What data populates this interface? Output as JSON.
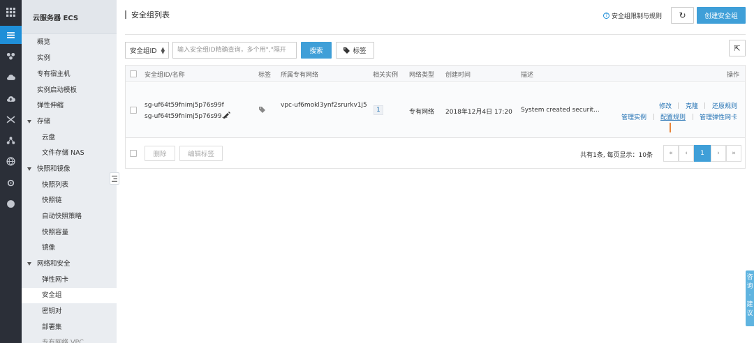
{
  "sidebar": {
    "title": "云服务器 ECS",
    "items": [
      {
        "label": "概览"
      },
      {
        "label": "实例"
      },
      {
        "label": "专有宿主机"
      },
      {
        "label": "实例启动模板"
      },
      {
        "label": "弹性伸缩"
      },
      {
        "label": "存储"
      },
      {
        "label": "云盘"
      },
      {
        "label": "文件存储 NAS"
      },
      {
        "label": "快照和镜像"
      },
      {
        "label": "快照列表"
      },
      {
        "label": "快照链"
      },
      {
        "label": "自动快照策略"
      },
      {
        "label": "快照容量"
      },
      {
        "label": "镜像"
      },
      {
        "label": "网络和安全"
      },
      {
        "label": "弹性网卡"
      },
      {
        "label": "安全组"
      },
      {
        "label": "密钥对"
      },
      {
        "label": "部署集"
      },
      {
        "label": "专有网络 VPC"
      }
    ]
  },
  "page": {
    "title": "安全组列表",
    "help_link": "安全组限制与规则",
    "refresh_icon": "↻",
    "create_button": "创建安全组",
    "export_icon": "⇱"
  },
  "filter": {
    "select_value": "安全组ID",
    "search_placeholder": "输入安全组ID精确查询，多个用\",\"隔开",
    "search_button": "搜索",
    "tag_button": "标签"
  },
  "table": {
    "headers": {
      "id_name": "安全组ID/名称",
      "tags": "标签",
      "vpc": "所属专有网络",
      "instances": "相关实例",
      "network_type": "网络类型",
      "created": "创建时间",
      "desc": "描述",
      "actions": "操作"
    },
    "rows": [
      {
        "id": "sg-uf64t59fnimj5p76s99f",
        "name": "sg-uf64t59fnimj5p76s99...",
        "vpc": "vpc-uf6mokl3ynf2srurkv1j5",
        "instances": "1",
        "network_type": "专有网络",
        "created": "2018年12月4日 17:20",
        "desc": "System created securit...",
        "actions": {
          "modify": "修改",
          "clone": "克隆",
          "restore": "还原规则",
          "manage_instances": "管理实例",
          "config_rules": "配置规则",
          "manage_eni": "管理弹性网卡"
        }
      }
    ],
    "footer": {
      "delete": "删除",
      "edit_tags": "编辑标签",
      "summary": "共有1条, 每页显示：10条",
      "first": "«",
      "prev": "‹",
      "current_page": "1",
      "next": "›",
      "last": "»"
    }
  },
  "feedback": {
    "label": "咨询·建议"
  },
  "colors": {
    "accent": "#3f9fd8",
    "link": "#1f6fb2",
    "rail": "#2b2f38",
    "rail_active": "#1f8fd8"
  }
}
